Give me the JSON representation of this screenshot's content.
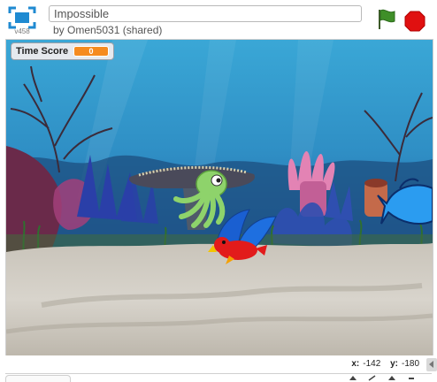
{
  "header": {
    "version": "v458",
    "project_title": "Impossible",
    "byline": "by Omen5031 (shared)"
  },
  "monitor": {
    "label": "Time Score",
    "value": "0"
  },
  "footer": {
    "x_label": "x:",
    "x_value": "-142",
    "y_label": "y:",
    "y_value": "-180"
  },
  "icons": [
    "fullscreen-icon",
    "green-flag-icon",
    "stop-sign-icon",
    "collapse-arrow-icon"
  ],
  "colors": {
    "flag": "#3f8f28",
    "stop": "#e01010",
    "monitor_value_bg": "#f58b1f",
    "stage_water": "#2c8fc4",
    "sand": "#cfcac0"
  }
}
